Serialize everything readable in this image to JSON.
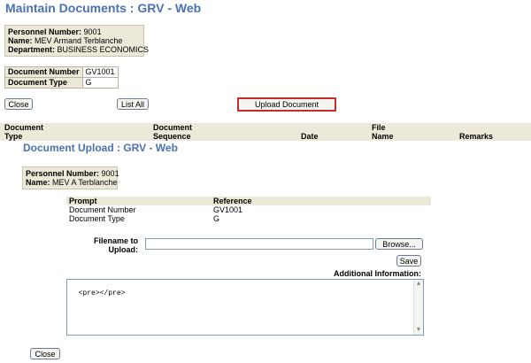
{
  "page_title": "Maintain Documents : GRV - Web",
  "employee": {
    "personnel_label": "Personnel Number:",
    "personnel_value": "9001",
    "name_label": "Name:",
    "name_value": "MEV Armand Terblanche",
    "department_label": "Department:",
    "department_value": "BUSINESS ECONOMICS"
  },
  "document": {
    "number_label": "Document Number",
    "number_value": "GV1001",
    "type_label": "Document Type",
    "type_value": "G"
  },
  "buttons": {
    "close": "Close",
    "list_all": "List All",
    "upload_document": "Upload Document"
  },
  "grid": {
    "col_doc_type": [
      "Document",
      "Type"
    ],
    "col_doc_seq": [
      "Document",
      "Sequence"
    ],
    "col_date": "Date",
    "col_file_name": [
      "File",
      "Name"
    ],
    "col_remarks": "Remarks"
  },
  "upload_dialog": {
    "title": "Document Upload : GRV - Web",
    "personnel_label": "Personnel Number:",
    "personnel_value": "9001",
    "name_label": "Name:",
    "name_value": "MEV A Terblanche",
    "prompt_header": "Prompt",
    "reference_header": "Reference",
    "rows": [
      {
        "prompt": "Document Number",
        "reference": "GV1001"
      },
      {
        "prompt": "Document Type",
        "reference": "G"
      }
    ],
    "filename_label_line1": "Filename to",
    "filename_label_line2": "Upload:",
    "filename_value": "",
    "browse_label": "Browse...",
    "save_label": "Save",
    "additional_info_label": "Additional Information:",
    "additional_info_value": "<pre></pre>",
    "close_label": "Close"
  }
}
